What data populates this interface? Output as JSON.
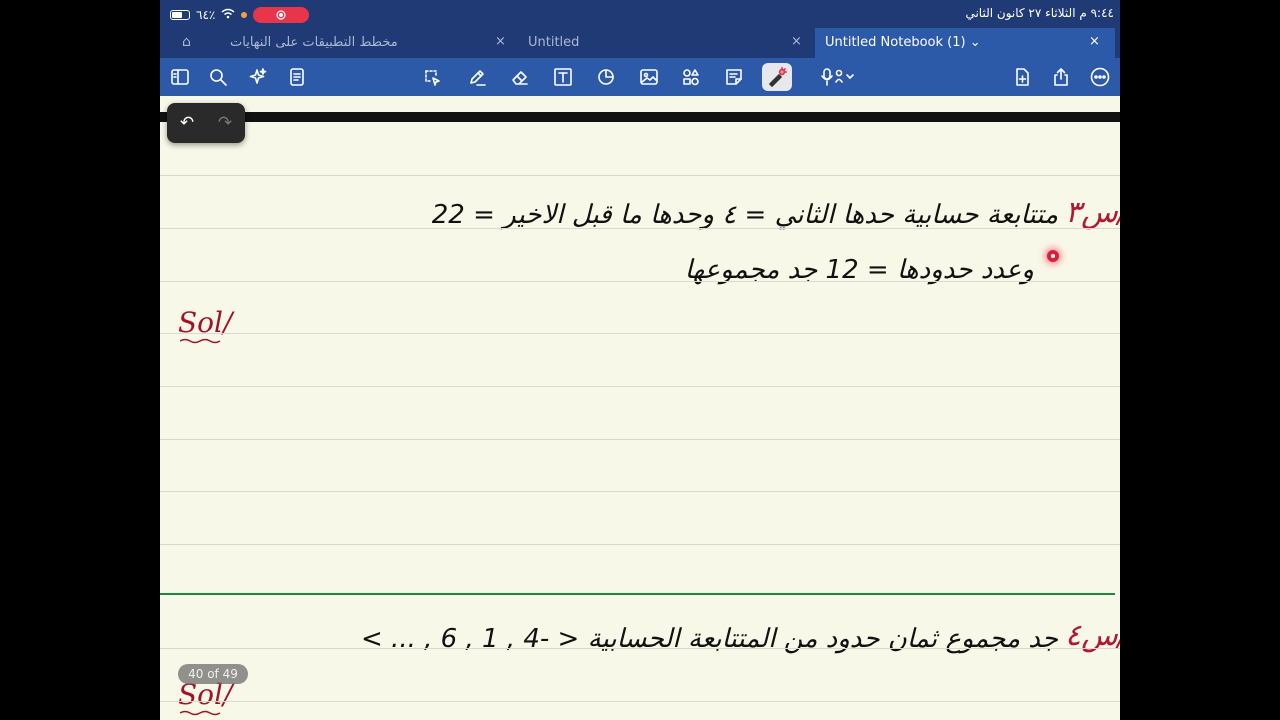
{
  "status_bar": {
    "battery": "٦٤٪",
    "datetime": "٩:٤٤ م  الثلاثاء ٢٧ كانون الثاني",
    "record_icon": "record-icon"
  },
  "tabs": [
    {
      "title": "مخطط التطبيقات على النهايات",
      "close": "×"
    },
    {
      "title": "Untitled",
      "close": "×"
    },
    {
      "title": "Untitled Notebook (1) ⌄",
      "close": "×",
      "active": true
    }
  ],
  "toolbar": {
    "left": [
      "sidebar-icon",
      "search-icon",
      "sparkle-icon",
      "outline-icon"
    ],
    "center": [
      "lasso-icon",
      "pen-icon",
      "eraser-icon",
      "text-icon",
      "shapes-icon",
      "image-icon",
      "elements-icon",
      "sticky-note-icon",
      "laser-pointer-icon",
      "microphone-icon"
    ],
    "right": [
      "add-page-icon",
      "share-icon",
      "more-icon"
    ]
  },
  "undo_bar": {
    "undo": "↶",
    "redo": "↷"
  },
  "notes": {
    "q1_mark": "س٣/",
    "q1_line1": "متتابعة حسابية حدها الثاني = ٤ وحدها ما قبل الاخير = 22",
    "q1_line2": "وعدد حدودها = 12 جد مجموعها",
    "sol_label": "Sol/",
    "q2_mark": "س٤/",
    "q2_line": "جد مجموع ثمان حدود من المتتابعة الحسابية < -4 , 1 , 6 , ... >",
    "sol2_label": "Sol/"
  },
  "pager": "40 of 49",
  "colors": {
    "nav": "#1f3a74",
    "toolbar": "#2c5aa8",
    "paper": "#f8f8e8",
    "ink_red": "#b01830",
    "divider_green": "#1b8a3f"
  }
}
